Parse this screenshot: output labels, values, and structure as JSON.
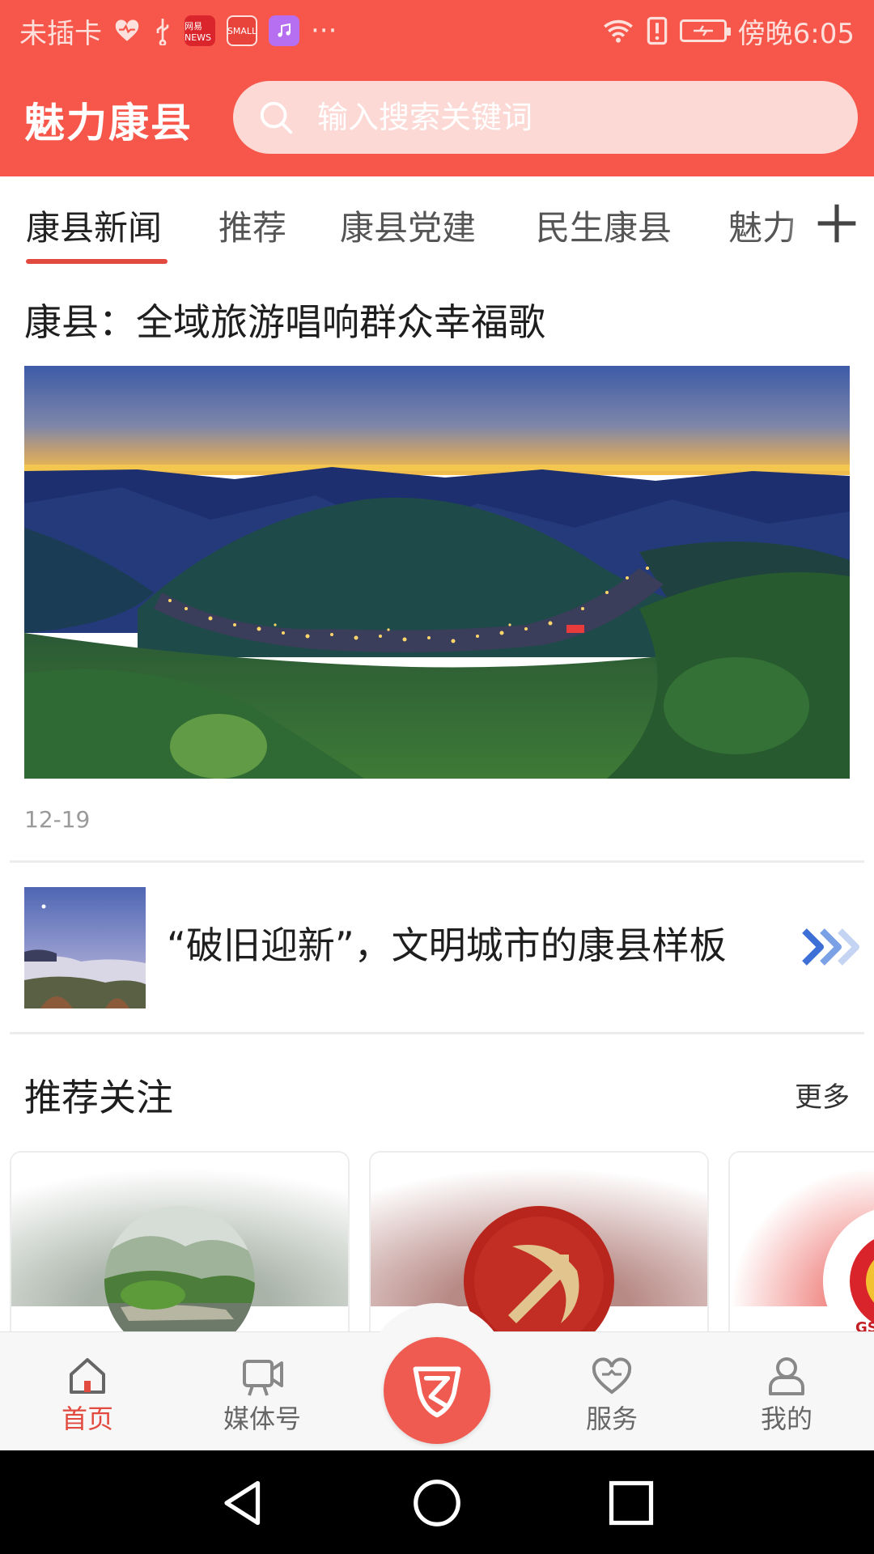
{
  "status_bar": {
    "carrier": "未插卡",
    "app_badges": [
      "heart-icon",
      "usb-icon",
      "netease-news-icon",
      "mall-icon",
      "music-icon"
    ],
    "news_badge": "网易 NEWS",
    "mall_badge": "SMALL",
    "more": "···",
    "icons": [
      "wifi-icon",
      "alert-icon",
      "battery-icon"
    ],
    "time": "傍晚6:05"
  },
  "header": {
    "app_title": "魅力康县",
    "search_placeholder": "输入搜索关键词",
    "background_color": "#f7574b"
  },
  "tabs": [
    {
      "label": "康县新闻",
      "active": true
    },
    {
      "label": "推荐",
      "active": false
    },
    {
      "label": "康县党建",
      "active": false
    },
    {
      "label": "民生康县",
      "active": false
    },
    {
      "label": "魅力",
      "active": false
    }
  ],
  "featured": {
    "title": "康县：全域旅游唱响群众幸福歌",
    "date": "12-19"
  },
  "article": {
    "title": "“破旧迎新”，文明城市的康县样板"
  },
  "recommended": {
    "title": "推荐关注",
    "more_label": "更多",
    "cards": [
      {
        "avatar": "river-landscape-avatar"
      },
      {
        "avatar": "party-emblem-avatar"
      },
      {
        "avatar": "national-emblem-avatar",
        "emblem_text": "GS"
      }
    ]
  },
  "bottom_nav": {
    "items": [
      {
        "label": "首页",
        "icon": "home-icon",
        "active": true
      },
      {
        "label": "媒体号",
        "icon": "video-camera-icon",
        "active": false
      },
      {
        "label": "服务",
        "icon": "heart-icon",
        "active": false
      },
      {
        "label": "我的",
        "icon": "user-icon",
        "active": false
      }
    ],
    "center_icon": "app-logo-icon",
    "accent_color": "#e34a3f"
  },
  "system_nav": [
    "back-icon",
    "home-circle-icon",
    "recents-icon"
  ]
}
